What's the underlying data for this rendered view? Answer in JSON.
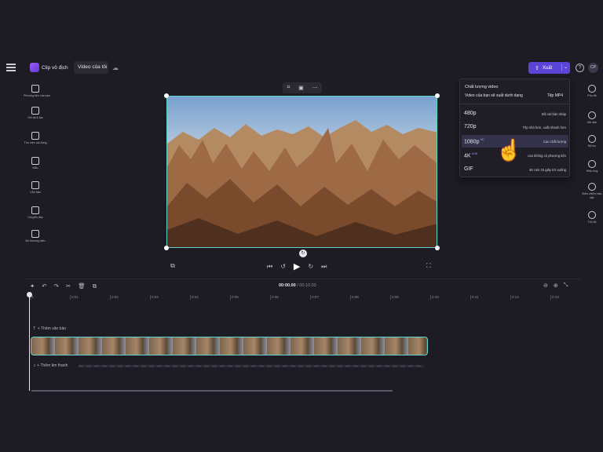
{
  "topbar": {
    "logo_text": "Clip vô địch",
    "project_name": "Video của tôi",
    "export_label": "Xuất",
    "help": "?",
    "avatar_initials": "CP"
  },
  "left_sidebar": [
    {
      "label": "Phương tiện của bạn",
      "icon": "folder-icon"
    },
    {
      "label": "Ghi lại & tạo",
      "icon": "camera-icon"
    },
    {
      "label": "Thư viện nội dung",
      "icon": "library-icon"
    },
    {
      "label": "Mẫu",
      "icon": "templates-icon"
    },
    {
      "label": "Văn bản",
      "icon": "text-icon"
    },
    {
      "label": "Chuyển tiếp",
      "icon": "transitions-icon"
    },
    {
      "label": "Bộ thương hiệu",
      "icon": "brand-icon"
    }
  ],
  "right_sidebar": [
    {
      "label": "Phụ đề",
      "icon": "captions-icon"
    },
    {
      "label": "Mờ dần",
      "icon": "fade-icon"
    },
    {
      "label": "Bộ lọc",
      "icon": "filter-icon"
    },
    {
      "label": "Hiệu ứng",
      "icon": "effects-icon"
    },
    {
      "label": "Điều chỉnh màu sắc",
      "icon": "color-icon"
    },
    {
      "label": "Tốc độ",
      "icon": "speed-icon"
    }
  ],
  "export_menu": {
    "title": "Chất lượng video",
    "subtitle": "Video của bạn sẽ xuất dưới dạng",
    "format": "Tệp MP4",
    "options": [
      {
        "res": "480p",
        "badge": "",
        "desc": "Đồ nét bản nháp"
      },
      {
        "res": "720p",
        "badge": "",
        "desc": "Tệp nhỏ hơn, xuất nhanh hơn"
      },
      {
        "res": "1080p",
        "badge": "HD",
        "desc": "Cao chất lượng"
      },
      {
        "res": "4K",
        "badge": "UHD",
        "desc": "cao không có phương tiện"
      },
      {
        "res": "GIF",
        "badge": "",
        "desc": "4K nén 15 giây trở xuống"
      }
    ],
    "selected_index": 2
  },
  "player": {
    "current_time": "00:00.00",
    "total_time": "/ 00:10.03"
  },
  "timeline": {
    "ticks": [
      "0",
      "0:01",
      "0:02",
      "0:03",
      "0:04",
      "0:05",
      "0:06",
      "0:07",
      "0:08",
      "0:09",
      "0:10",
      "0:11",
      "0:12",
      "0:13"
    ],
    "text_track": "Thêm văn bản",
    "audio_track": "Thêm âm thanh"
  }
}
